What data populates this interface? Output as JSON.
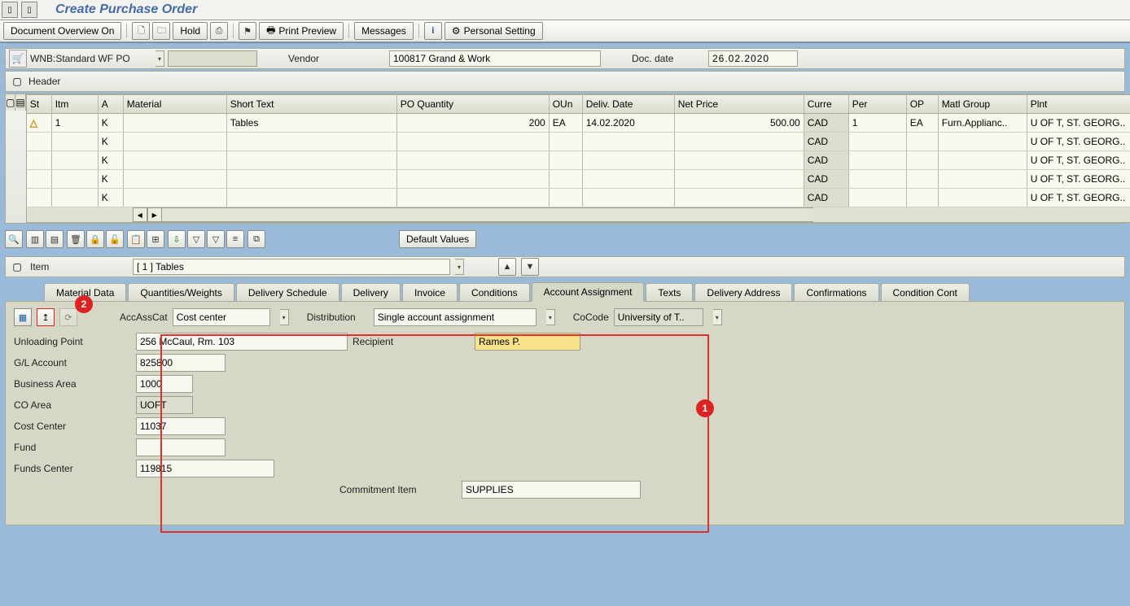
{
  "page_title": "Create Purchase Order",
  "toolbar": {
    "overview": "Document Overview On",
    "hold": "Hold",
    "preview": "Print Preview",
    "messages": "Messages",
    "personal": "Personal Setting"
  },
  "header_strip": {
    "po_type": "WNB:Standard WF PO",
    "vendor_label": "Vendor",
    "vendor_value": "100817 Grand & Work",
    "date_label": "Doc. date",
    "date_value": "26.02.2020",
    "header_label": "Header"
  },
  "grid": {
    "cols": {
      "st": "St",
      "itm": "Itm",
      "a": "A",
      "material": "Material",
      "short": "Short Text",
      "qty": "PO Quantity",
      "oun": "OUn",
      "deliv": "Deliv. Date",
      "np": "Net Price",
      "cur": "Curre",
      "per": "Per",
      "op": "OP",
      "mgrp": "Matl Group",
      "plnt": "Plnt"
    },
    "rows": [
      {
        "st": "⚠",
        "itm": "1",
        "a": "K",
        "material": "",
        "short": "Tables",
        "qty": "200",
        "oun": "EA",
        "deliv": "14.02.2020",
        "np": "500.00",
        "cur": "CAD",
        "per": "1",
        "op": "EA",
        "mgrp": "Furn.Applianc..",
        "plnt": "U OF T, ST. GEORG.."
      },
      {
        "st": "",
        "itm": "",
        "a": "K",
        "material": "",
        "short": "",
        "qty": "",
        "oun": "",
        "deliv": "",
        "np": "",
        "cur": "CAD",
        "per": "",
        "op": "",
        "mgrp": "",
        "plnt": "U OF T, ST. GEORG.."
      },
      {
        "st": "",
        "itm": "",
        "a": "K",
        "material": "",
        "short": "",
        "qty": "",
        "oun": "",
        "deliv": "",
        "np": "",
        "cur": "CAD",
        "per": "",
        "op": "",
        "mgrp": "",
        "plnt": "U OF T, ST. GEORG.."
      },
      {
        "st": "",
        "itm": "",
        "a": "K",
        "material": "",
        "short": "",
        "qty": "",
        "oun": "",
        "deliv": "",
        "np": "",
        "cur": "CAD",
        "per": "",
        "op": "",
        "mgrp": "",
        "plnt": "U OF T, ST. GEORG.."
      },
      {
        "st": "",
        "itm": "",
        "a": "K",
        "material": "",
        "short": "",
        "qty": "",
        "oun": "",
        "deliv": "",
        "np": "",
        "cur": "CAD",
        "per": "",
        "op": "",
        "mgrp": "",
        "plnt": "U OF T, ST. GEORG.."
      }
    ]
  },
  "default_values_btn": "Default Values",
  "item_strip": {
    "label": "Item",
    "value": "[ 1 ] Tables"
  },
  "tabs": [
    "Material Data",
    "Quantities/Weights",
    "Delivery Schedule",
    "Delivery",
    "Invoice",
    "Conditions",
    "Account Assignment",
    "Texts",
    "Delivery Address",
    "Confirmations",
    "Condition Cont"
  ],
  "active_tab": 6,
  "account": {
    "acc_cat_label": "AccAssCat",
    "acc_cat_value": "Cost center",
    "dist_label": "Distribution",
    "dist_value": "Single account assignment",
    "cocode_label": "CoCode",
    "cocode_value": "University of T..",
    "unloading_label": "Unloading Point",
    "unloading_value": "256 McCaul, Rm. 103",
    "recipient_label": "Recipient",
    "recipient_value": "Rames P.",
    "gl_label": "G/L Account",
    "gl_value": "825800",
    "ba_label": "Business Area",
    "ba_value": "1000",
    "coarea_label": "CO Area",
    "coarea_value": "UOFT",
    "cc_label": "Cost Center",
    "cc_value": "11037",
    "fund_label": "Fund",
    "fund_value": "",
    "fc_label": "Funds Center",
    "fc_value": "119815",
    "ci_label": "Commitment Item",
    "ci_value": "SUPPLIES"
  },
  "annotations": {
    "n1": "1",
    "n2": "2"
  }
}
